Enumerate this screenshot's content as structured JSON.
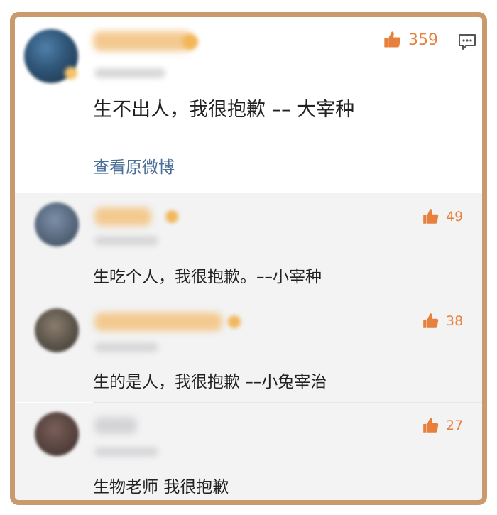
{
  "colors": {
    "frame": "#c99a6b",
    "accent_like": "#e8803d",
    "link": "#4a6f99",
    "reply_background": "#f3f3f4"
  },
  "main_comment": {
    "like_icon": "thumbs-up-icon",
    "like_count": "359",
    "reply_icon": "comment-icon",
    "text": "生不出人，我很抱歉 –– 大宰种",
    "view_original_label": "查看原微博"
  },
  "replies": [
    {
      "like_icon": "thumbs-up-icon",
      "like_count": "49",
      "text": "生吃个人，我很抱歉。––小宰种"
    },
    {
      "like_icon": "thumbs-up-icon",
      "like_count": "38",
      "text": "生的是人，我很抱歉 ––小兔宰治"
    },
    {
      "like_icon": "thumbs-up-icon",
      "like_count": "27",
      "text": "生物老师 我很抱歉"
    }
  ]
}
